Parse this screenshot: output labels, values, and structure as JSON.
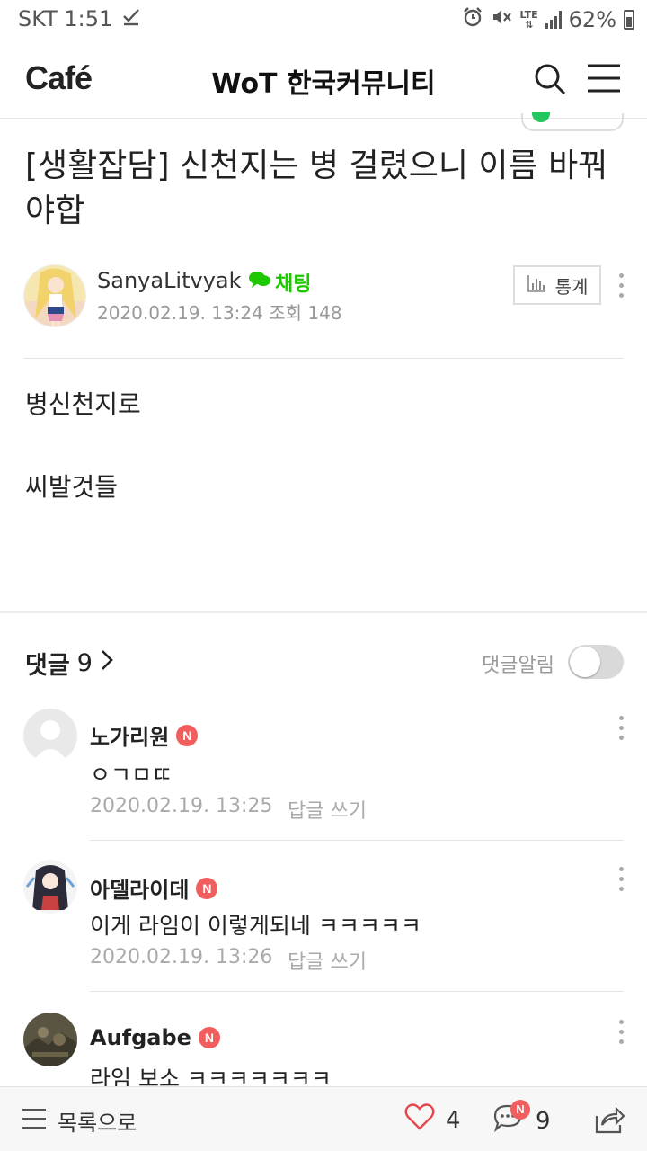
{
  "status_bar": {
    "carrier_time": "SKT 1:51",
    "network": "LTE",
    "battery": "62%",
    "icons": [
      "check-icon",
      "alarm-icon",
      "mute-icon",
      "signal-icon",
      "battery-icon"
    ]
  },
  "header": {
    "logo": "Café",
    "cafe_name": "WoT 한국커뮤니티"
  },
  "post": {
    "title": "[생활잡담] 신천지는 병 걸렸으니 이름 바꿔야합",
    "author": "SanyaLitvyak",
    "chat_label": "채팅",
    "date": "2020.02.19. 13:24",
    "views_label": "조회",
    "views": "148",
    "stats_label": "통계",
    "body": [
      "병신천지로",
      "씨발것들"
    ]
  },
  "comments": {
    "heading": "댓글",
    "count": "9",
    "notify_label": "댓글알림",
    "notify_on": false,
    "reply_label": "답글 쓰기",
    "new_badge": "N",
    "items": [
      {
        "name": "노가리원",
        "text": "ㅇㄱㅁㄸ",
        "date": "2020.02.19. 13:25"
      },
      {
        "name": "아델라이데",
        "text": "이게 라임이 이렇게되네 ㅋㅋㅋㅋㅋ",
        "date": "2020.02.19. 13:26"
      },
      {
        "name": "Aufgabe",
        "text": "라임 보소 ㅋㅋㅋㅋㅋㅋㅋ",
        "date": ""
      }
    ]
  },
  "bottom_bar": {
    "list_label": "목록으로",
    "likes": "4",
    "comments": "9",
    "comment_badge": "N"
  },
  "colors": {
    "accent_green": "#1ec800",
    "new_badge_red": "#f25d5d",
    "like_red": "#e8464c"
  }
}
